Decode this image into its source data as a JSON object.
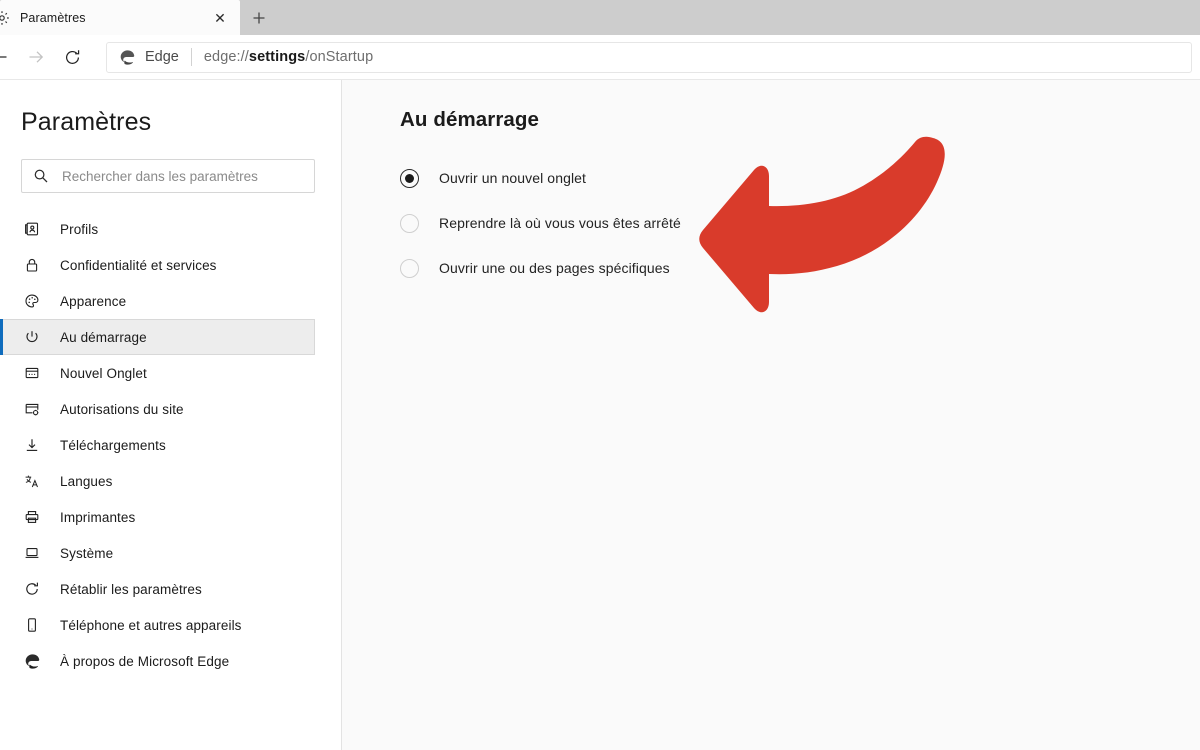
{
  "browser": {
    "tab": {
      "title": "Paramètres",
      "favicon_icon": "settings-gear-icon",
      "close_icon": "close-icon",
      "close_glyph": "✕"
    },
    "new_tab_button": {
      "icon": "plus-icon",
      "label": "+"
    },
    "toolbar": {
      "back_icon": "arrow-left-icon",
      "forward_icon": "arrow-right-icon",
      "reload_icon": "refresh-icon",
      "address_bar": {
        "brand_icon": "edge-logo-icon",
        "brand_label": "Edge",
        "url_scheme": "edge://",
        "url_host": "settings",
        "url_path": "/onStartup",
        "full_url": "edge://settings/onStartup"
      }
    }
  },
  "sidebar": {
    "title": "Paramètres",
    "search": {
      "icon": "search-icon",
      "placeholder": "Rechercher dans les paramètres",
      "value": ""
    },
    "items": [
      {
        "label": "Profils",
        "icon": "profile-card-icon",
        "selected": false
      },
      {
        "label": "Confidentialité et services",
        "icon": "lock-icon",
        "selected": false
      },
      {
        "label": "Apparence",
        "icon": "palette-icon",
        "selected": false
      },
      {
        "label": "Au démarrage",
        "icon": "power-icon",
        "selected": true
      },
      {
        "label": "Nouvel Onglet",
        "icon": "new-tab-page-icon",
        "selected": false
      },
      {
        "label": "Autorisations du site",
        "icon": "site-permissions-icon",
        "selected": false
      },
      {
        "label": "Téléchargements",
        "icon": "download-icon",
        "selected": false
      },
      {
        "label": "Langues",
        "icon": "languages-icon",
        "selected": false
      },
      {
        "label": "Imprimantes",
        "icon": "printer-icon",
        "selected": false
      },
      {
        "label": "Système",
        "icon": "laptop-icon",
        "selected": false
      },
      {
        "label": "Rétablir les paramètres",
        "icon": "reset-icon",
        "selected": false
      },
      {
        "label": "Téléphone et autres appareils",
        "icon": "phone-icon",
        "selected": false
      },
      {
        "label": "À propos de Microsoft Edge",
        "icon": "edge-logo-icon",
        "selected": false
      }
    ]
  },
  "main": {
    "title": "Au démarrage",
    "options": [
      {
        "label": "Ouvrir un nouvel onglet",
        "checked": true
      },
      {
        "label": "Reprendre là où vous vous êtes arrêté",
        "checked": false
      },
      {
        "label": "Ouvrir une ou des pages spécifiques",
        "checked": false
      }
    ],
    "annotation": {
      "icon": "curved-arrow-left-annotation",
      "color": "#d93b2b"
    }
  },
  "colors": {
    "accent_blue": "#0f6cbd",
    "annotation_red": "#d93b2b",
    "tabstrip_gray": "#cdcdcd",
    "content_bg": "#fafafa",
    "selected_item_bg": "#ededed"
  }
}
